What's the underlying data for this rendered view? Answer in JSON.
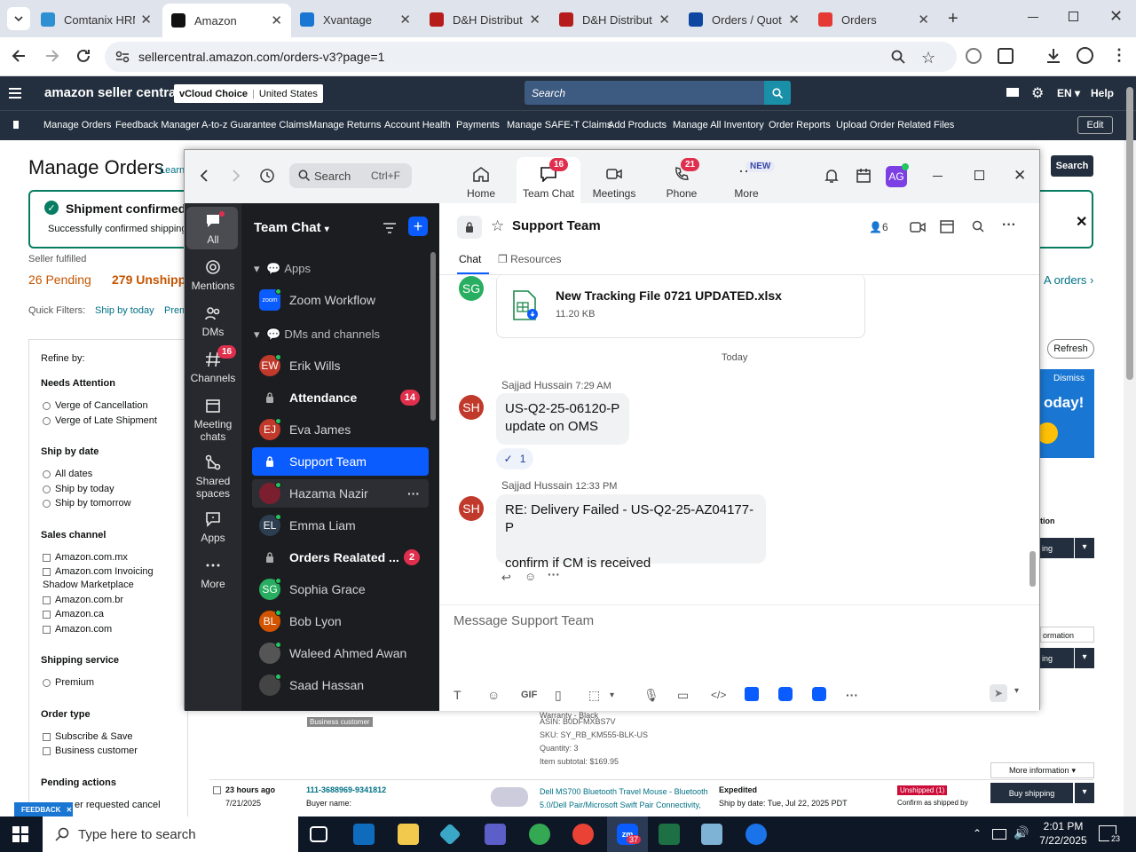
{
  "browser": {
    "tabs": [
      {
        "title": "Comtanix HRM",
        "favicon_color": "#2f8fd3"
      },
      {
        "title": "Amazon",
        "favicon_color": "#111111"
      },
      {
        "title": "Xvantage",
        "favicon_color": "#1976d2"
      },
      {
        "title": "D&H Distribut",
        "favicon_color": "#b71c1c"
      },
      {
        "title": "D&H Distribut",
        "favicon_color": "#b71c1c"
      },
      {
        "title": "Orders / Quot",
        "favicon_color": "#0d47a1"
      },
      {
        "title": "Orders",
        "favicon_color": "#e53935"
      }
    ],
    "url": "sellercentral.amazon.com/orders-v3?page=1"
  },
  "amazon": {
    "logo": "amazon seller central",
    "store": "vCloud Choice",
    "region": "United States",
    "search_placeholder": "Search",
    "lang": "EN",
    "help": "Help",
    "nav": [
      "Manage Orders",
      "Feedback Manager",
      "A-to-z Guarantee Claims",
      "Manage Returns",
      "Account Health",
      "Payments",
      "Manage SAFE-T Claims",
      "Add Products",
      "Manage All Inventory",
      "Order Reports",
      "Upload Order Related Files"
    ],
    "edit": "Edit",
    "page_title": "Manage Orders",
    "learn": "Learn",
    "search_btn": "Search",
    "alert_title": "Shipment confirmed",
    "alert_text": "Successfully confirmed shipping",
    "seller_fulfilled": "Seller fulfilled",
    "pending": "26 Pending",
    "unshipped": "279 Unshipp",
    "fba_orders": "A orders ›",
    "quick_filters": "Quick Filters:",
    "ship_by_today": "Ship by today",
    "prem": "Prem",
    "refresh": "Refresh",
    "dismiss": "Dismiss",
    "promo_text": "oday!",
    "action_lbl": "tion",
    "ship_btn_part": "ing",
    "more_info_part": "ormation",
    "sidebar": {
      "refine": "Refine by:",
      "needs_attention": "Needs Attention",
      "na_items": [
        "Verge of Cancellation",
        "Verge of Late Shipment"
      ],
      "ship_by_date": "Ship by date",
      "sbd_items": [
        "All dates",
        "Ship by today",
        "Ship by tomorrow"
      ],
      "sales_channel": "Sales channel",
      "sc_items": [
        "Amazon.com.mx",
        "Amazon.com Invoicing",
        "Shadow Marketplace",
        "Amazon.com.br",
        "Amazon.ca",
        "Amazon.com"
      ],
      "shipping_service": "Shipping service",
      "ss_items": [
        "Premium"
      ],
      "order_type": "Order type",
      "ot_items": [
        "Subscribe & Save",
        "Business customer"
      ],
      "pending_actions": "Pending actions",
      "pa_item": "er requested cancel",
      "feedback": "FEEDBACK"
    },
    "order1": {
      "business": "Business customer",
      "warranty": "Warranty - Black",
      "asin": "ASIN: B0DFMXBS7V",
      "sku": "SKU: SY_RB_KM555-BLK-US",
      "qty": "Quantity: 3",
      "subtotal": "Item subtotal: $169.95",
      "more_info": "More information"
    },
    "order2": {
      "age": "23 hours ago",
      "date": "7/21/2025",
      "order_id": "111-3688969-9341812",
      "buyer": "Buyer name:",
      "product": "Dell MS700 Bluetooth Travel Mouse - Bluetooth 5.0/Dell Pair/Microsoft Swift Pair Connectivity,",
      "service": "Expedited",
      "ship_by": "Ship by date: Tue, Jul 22, 2025 PDT",
      "status": "Unshipped (1)",
      "confirm": "Confirm as shipped by",
      "buy_shipping": "Buy shipping"
    }
  },
  "zoom": {
    "topnav": {
      "search": "Search",
      "shortcut": "Ctrl+F",
      "home": "Home",
      "team_chat": "Team Chat",
      "team_chat_badge": "16",
      "meetings": "Meetings",
      "phone": "Phone",
      "phone_badge": "21",
      "more": "More",
      "new": "NEW",
      "avatar": "AG"
    },
    "rail": [
      {
        "label": "All",
        "badge": ""
      },
      {
        "label": "Mentions",
        "badge": ""
      },
      {
        "label": "DMs",
        "badge": ""
      },
      {
        "label": "Channels",
        "badge": "16"
      },
      {
        "label": "Meeting chats",
        "badge": ""
      },
      {
        "label": "Shared spaces",
        "badge": ""
      },
      {
        "label": "Apps",
        "badge": ""
      },
      {
        "label": "More",
        "badge": ""
      }
    ],
    "list_title": "Team Chat",
    "sections": {
      "apps": "Apps",
      "dms": "DMs and channels"
    },
    "chats": [
      {
        "name": "Zoom Workflow",
        "initials": "zoom",
        "color": "#0b5cff",
        "badge": "",
        "bold": false,
        "lock": false
      },
      {
        "name": "Erik Wills",
        "initials": "EW",
        "color": "#c0392b",
        "badge": "",
        "bold": false,
        "lock": false
      },
      {
        "name": "Attendance",
        "initials": "",
        "color": "",
        "badge": "14",
        "bold": true,
        "lock": true
      },
      {
        "name": "Eva James",
        "initials": "EJ",
        "color": "#c0392b",
        "badge": "",
        "bold": false,
        "lock": false
      },
      {
        "name": "Support Team",
        "initials": "",
        "color": "",
        "badge": "",
        "bold": false,
        "lock": true
      },
      {
        "name": "Hazama Nazir",
        "initials": "",
        "color": "#7b1f2e",
        "badge": "",
        "bold": false,
        "lock": false
      },
      {
        "name": "Emma Liam",
        "initials": "EL",
        "color": "#2c3e50",
        "badge": "",
        "bold": false,
        "lock": false
      },
      {
        "name": "Orders Realated ...",
        "initials": "",
        "color": "",
        "badge": "2",
        "bold": true,
        "lock": true
      },
      {
        "name": "Sophia Grace",
        "initials": "SG",
        "color": "#27ae60",
        "badge": "",
        "bold": false,
        "lock": false
      },
      {
        "name": "Bob Lyon",
        "initials": "BL",
        "color": "#d35400",
        "badge": "",
        "bold": false,
        "lock": false
      },
      {
        "name": "Waleed Ahmed Awan",
        "initials": "",
        "color": "#555555",
        "badge": "",
        "bold": false,
        "lock": false
      },
      {
        "name": "Saad Hassan",
        "initials": "",
        "color": "#444444",
        "badge": "",
        "bold": false,
        "lock": false
      }
    ],
    "channel": {
      "name": "Support Team",
      "members": "6",
      "tab_chat": "Chat",
      "tab_resources": "Resources"
    },
    "file": {
      "sender_initials": "SG",
      "name": "New Tracking File 0721 UPDATED.xlsx",
      "size": "11.20 KB"
    },
    "day_divider": "Today",
    "messages": [
      {
        "initials": "SH",
        "sender": "Sajjad Hussain",
        "time": "7:29 AM",
        "line1": "US-Q2-25-06120-P",
        "line2": "update on OMS",
        "reaction": "✓",
        "reaction_count": "1"
      },
      {
        "initials": "SH",
        "sender": "Sajjad Hussain",
        "time": "12:33 PM",
        "line1": "RE: Delivery Failed - US-Q2-25-AZ04177-P",
        "line2": "confirm if CM is received"
      }
    ],
    "composer_placeholder": "Message Support Team",
    "gif": "GIF"
  },
  "taskbar": {
    "search": "Type here to search",
    "time": "2:01 PM",
    "date": "7/22/2025",
    "notif": "23",
    "zoom_badge": "37"
  }
}
